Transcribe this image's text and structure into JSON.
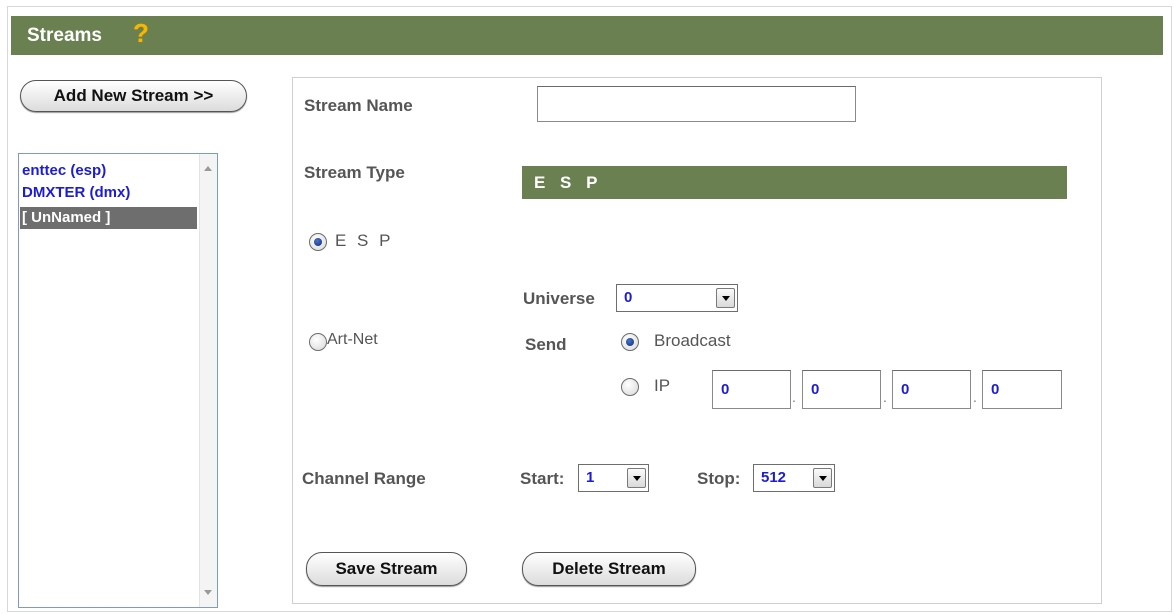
{
  "header": {
    "title": "Streams",
    "help_glyph": "?"
  },
  "sidebar": {
    "add_button": "Add New Stream >>",
    "streams": [
      {
        "label": "enttec (esp)",
        "selected": false
      },
      {
        "label": "DMXTER (dmx)",
        "selected": false
      },
      {
        "label": "[ UnNamed ]",
        "selected": true
      }
    ]
  },
  "form": {
    "stream_name_label": "Stream Name",
    "stream_name_value": "",
    "stream_type_label": "Stream Type",
    "stream_type_value": "E S P",
    "esp_option": {
      "label": "E S P",
      "checked": true
    },
    "artnet_option": {
      "label": "Art-Net",
      "checked": false
    },
    "universe_label": "Universe",
    "universe_value": "0",
    "send_label": "Send",
    "broadcast_option": {
      "label": "Broadcast",
      "checked": true
    },
    "ip_option": {
      "label": "IP",
      "checked": false
    },
    "ip_octets": [
      "0",
      "0",
      "0",
      "0"
    ],
    "channel_range_label": "Channel Range",
    "start_label": "Start:",
    "start_value": "1",
    "stop_label": "Stop:",
    "stop_value": "512",
    "save_button": "Save Stream",
    "delete_button": "Delete Stream"
  },
  "colors": {
    "header_bg": "#6a8051",
    "link_blue": "#1c1cd6",
    "selected_bg": "#6e6e6e",
    "help_icon": "#f5b800"
  }
}
